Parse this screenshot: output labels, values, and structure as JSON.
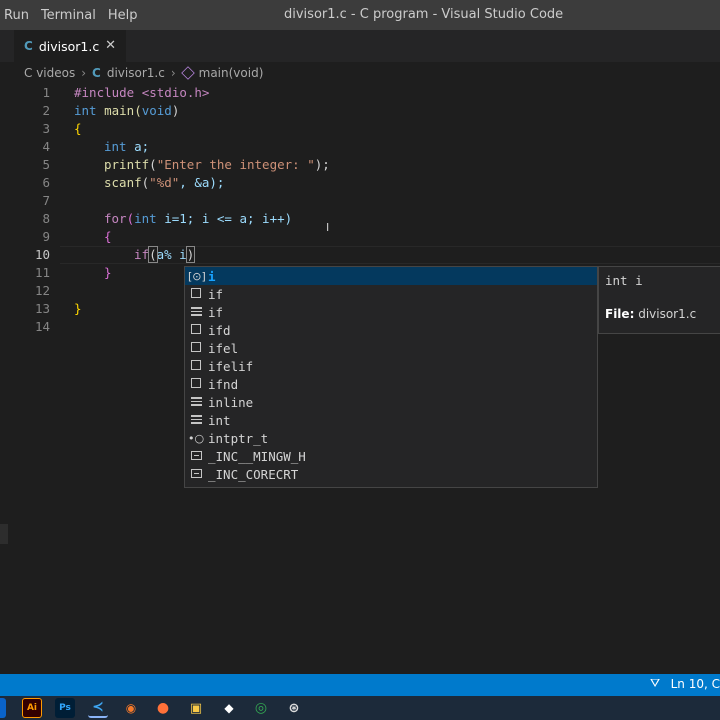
{
  "menu": [
    "Run",
    "Terminal",
    "Help"
  ],
  "window_title": "divisor1.c - C program - Visual Studio Code",
  "tab": {
    "icon": "C",
    "label": "divisor1.c",
    "close": "✕"
  },
  "breadcrumb": {
    "folder": "C videos",
    "file_icon": "C",
    "file": "divisor1.c",
    "symbol": "main(void)"
  },
  "editor": {
    "line_numbers": [
      "1",
      "2",
      "3",
      "4",
      "5",
      "6",
      "7",
      "8",
      "9",
      "10",
      "11",
      "12",
      "13",
      "14"
    ],
    "active_line": "10",
    "lines": [
      {
        "a": "#include <stdio.h>"
      },
      {
        "a": "int",
        "b": " main(",
        "c": "void",
        "d": ")"
      },
      {
        "a": "{"
      },
      {
        "a": "int",
        "b": " a;"
      },
      {
        "a": "printf",
        "b": "(",
        "c": "\"Enter the integer: \"",
        "d": ");"
      },
      {
        "a": "scanf",
        "b": "(",
        "c": "\"%d\"",
        "d": ", &a);"
      },
      {
        "a": ""
      },
      {
        "a": "for",
        "b": "(",
        "c": "int",
        "d": " i=1; i <= a; i++)"
      },
      {
        "a": "{"
      },
      {
        "a": "if",
        "b": "(",
        "c": "a% i",
        "d": ")"
      },
      {
        "a": "}"
      },
      {
        "a": ""
      },
      {
        "a": "}"
      },
      {
        "a": ""
      }
    ]
  },
  "suggestions": [
    {
      "icon": "variable-icon",
      "label": "i",
      "selected": true
    },
    {
      "icon": "snippet-icon",
      "label": "if"
    },
    {
      "icon": "keyword-icon",
      "label": "if"
    },
    {
      "icon": "snippet-icon",
      "label": "ifd"
    },
    {
      "icon": "snippet-icon",
      "label": "ifel"
    },
    {
      "icon": "snippet-icon",
      "label": "ifelif"
    },
    {
      "icon": "snippet-icon",
      "label": "ifnd"
    },
    {
      "icon": "keyword-icon",
      "label": "inline"
    },
    {
      "icon": "keyword-icon",
      "label": "int"
    },
    {
      "icon": "interface-icon",
      "label": "intptr_t"
    },
    {
      "icon": "constant-icon",
      "label": "_INC__MINGW_H"
    },
    {
      "icon": "constant-icon",
      "label": "_INC_CORECRT"
    }
  ],
  "details": {
    "signature": "int i",
    "file_label": "File:",
    "file_value": "divisor1.c"
  },
  "status": {
    "position": "Ln 10, C"
  },
  "taskbar": [
    "Ai",
    "Ps"
  ],
  "colors": {
    "status_bar": "#007acc",
    "selection": "#04395e",
    "match": "#18a3ff"
  }
}
